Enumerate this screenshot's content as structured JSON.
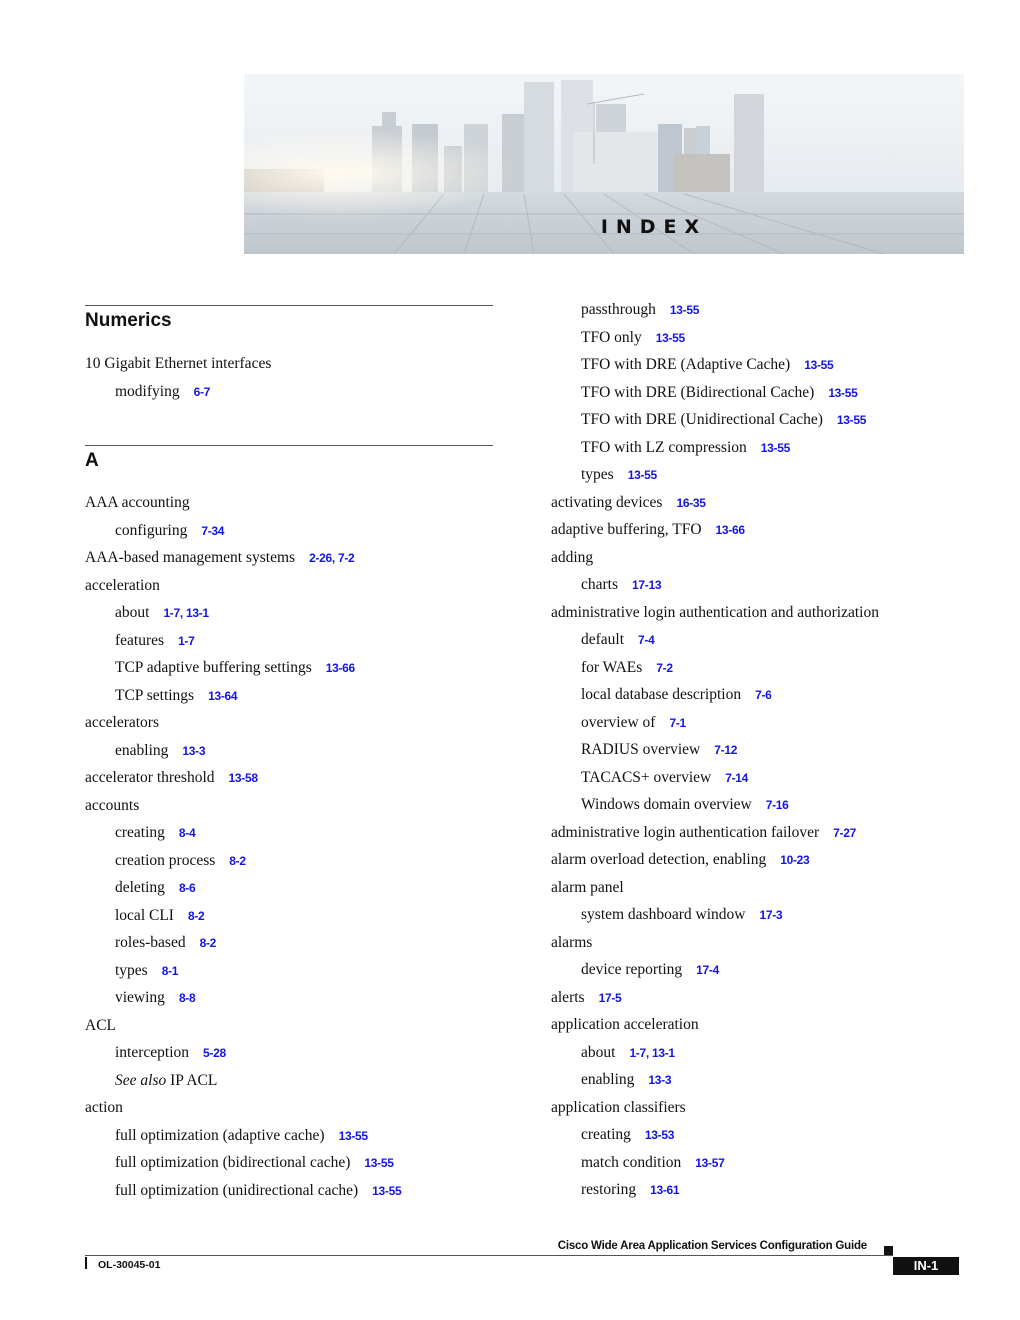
{
  "banner": {
    "title": "INDEX"
  },
  "left_column": {
    "sections": [
      {
        "heading": "Numerics",
        "entries": [
          {
            "text": "10 Gigabit Ethernet interfaces",
            "level": 0,
            "pages": ""
          },
          {
            "text": "modifying",
            "level": 1,
            "pages": "6-7"
          }
        ]
      },
      {
        "heading": "A",
        "entries": [
          {
            "text": "AAA accounting",
            "level": 0,
            "pages": ""
          },
          {
            "text": "configuring",
            "level": 1,
            "pages": "7-34"
          },
          {
            "text": "AAA-based management systems",
            "level": 0,
            "pages": "2-26, 7-2"
          },
          {
            "text": "acceleration",
            "level": 0,
            "pages": ""
          },
          {
            "text": "about",
            "level": 1,
            "pages": "1-7, 13-1"
          },
          {
            "text": "features",
            "level": 1,
            "pages": "1-7"
          },
          {
            "text": "TCP adaptive buffering settings",
            "level": 1,
            "pages": "13-66"
          },
          {
            "text": "TCP settings",
            "level": 1,
            "pages": "13-64"
          },
          {
            "text": "accelerators",
            "level": 0,
            "pages": ""
          },
          {
            "text": "enabling",
            "level": 1,
            "pages": "13-3"
          },
          {
            "text": "accelerator threshold",
            "level": 0,
            "pages": "13-58"
          },
          {
            "text": "accounts",
            "level": 0,
            "pages": ""
          },
          {
            "text": "creating",
            "level": 1,
            "pages": "8-4"
          },
          {
            "text": "creation process",
            "level": 1,
            "pages": "8-2"
          },
          {
            "text": "deleting",
            "level": 1,
            "pages": "8-6"
          },
          {
            "text": "local CLI",
            "level": 1,
            "pages": "8-2"
          },
          {
            "text": "roles-based",
            "level": 1,
            "pages": "8-2"
          },
          {
            "text": "types",
            "level": 1,
            "pages": "8-1"
          },
          {
            "text": "viewing",
            "level": 1,
            "pages": "8-8"
          },
          {
            "text": "ACL",
            "level": 0,
            "pages": ""
          },
          {
            "text": "interception",
            "level": 1,
            "pages": "5-28"
          },
          {
            "text": "IP ACL",
            "italic_prefix": "See also",
            "level": 1,
            "pages": ""
          },
          {
            "text": "action",
            "level": 0,
            "pages": ""
          },
          {
            "text": "full optimization (adaptive cache)",
            "level": 1,
            "pages": "13-55"
          },
          {
            "text": "full optimization (bidirectional cache)",
            "level": 1,
            "pages": "13-55"
          },
          {
            "text": "full optimization (unidirectional cache)",
            "level": 1,
            "pages": "13-55"
          }
        ]
      }
    ]
  },
  "right_column": {
    "entries": [
      {
        "text": "passthrough",
        "level": 1,
        "pages": "13-55"
      },
      {
        "text": "TFO only",
        "level": 1,
        "pages": "13-55"
      },
      {
        "text": "TFO with DRE (Adaptive Cache)",
        "level": 1,
        "pages": "13-55"
      },
      {
        "text": "TFO with DRE (Bidirectional Cache)",
        "level": 1,
        "pages": "13-55"
      },
      {
        "text": "TFO with DRE (Unidirectional Cache)",
        "level": 1,
        "pages": "13-55"
      },
      {
        "text": "TFO with LZ compression",
        "level": 1,
        "pages": "13-55"
      },
      {
        "text": "types",
        "level": 1,
        "pages": "13-55"
      },
      {
        "text": "activating devices",
        "level": 0,
        "pages": "16-35"
      },
      {
        "text": "adaptive buffering, TFO",
        "level": 0,
        "pages": "13-66"
      },
      {
        "text": "adding",
        "level": 0,
        "pages": ""
      },
      {
        "text": "charts",
        "level": 1,
        "pages": "17-13"
      },
      {
        "text": "administrative login authentication and authorization",
        "level": 0,
        "pages": ""
      },
      {
        "text": "default",
        "level": 1,
        "pages": "7-4"
      },
      {
        "text": "for WAEs",
        "level": 1,
        "pages": "7-2"
      },
      {
        "text": "local database description",
        "level": 1,
        "pages": "7-6"
      },
      {
        "text": "overview of",
        "level": 1,
        "pages": "7-1"
      },
      {
        "text": "RADIUS overview",
        "level": 1,
        "pages": "7-12"
      },
      {
        "text": "TACACS+ overview",
        "level": 1,
        "pages": "7-14"
      },
      {
        "text": "Windows domain overview",
        "level": 1,
        "pages": "7-16"
      },
      {
        "text": "administrative login authentication failover",
        "level": 0,
        "pages": "7-27"
      },
      {
        "text": "alarm overload detection, enabling",
        "level": 0,
        "pages": "10-23"
      },
      {
        "text": "alarm panel",
        "level": 0,
        "pages": ""
      },
      {
        "text": "system dashboard window",
        "level": 1,
        "pages": "17-3"
      },
      {
        "text": "alarms",
        "level": 0,
        "pages": ""
      },
      {
        "text": "device reporting",
        "level": 1,
        "pages": "17-4"
      },
      {
        "text": "alerts",
        "level": 0,
        "pages": "17-5"
      },
      {
        "text": "application acceleration",
        "level": 0,
        "pages": ""
      },
      {
        "text": "about",
        "level": 1,
        "pages": "1-7, 13-1"
      },
      {
        "text": "enabling",
        "level": 1,
        "pages": "13-3"
      },
      {
        "text": "application classifiers",
        "level": 0,
        "pages": ""
      },
      {
        "text": "creating",
        "level": 1,
        "pages": "13-53"
      },
      {
        "text": "match condition",
        "level": 1,
        "pages": "13-57"
      },
      {
        "text": "restoring",
        "level": 1,
        "pages": "13-61"
      }
    ]
  },
  "footer": {
    "guide_title": "Cisco Wide Area Application Services Configuration Guide",
    "doc_number": "OL-30045-01",
    "page_number": "IN-1"
  },
  "colors": {
    "page_link": "#1414e6",
    "text": "#111111"
  }
}
